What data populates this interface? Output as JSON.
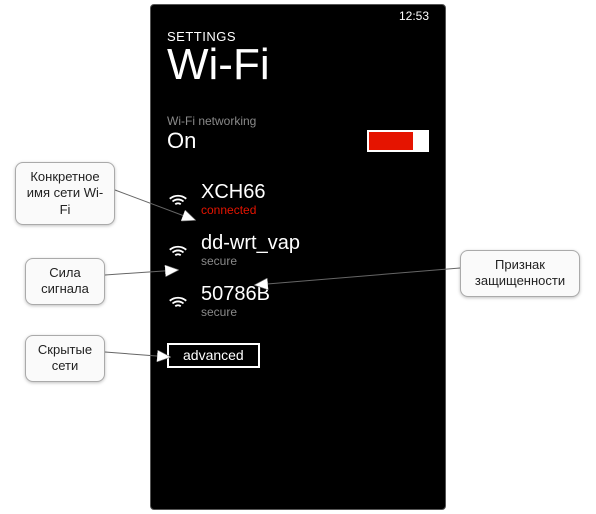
{
  "statusbar": {
    "time": "12:53"
  },
  "header": {
    "small": "SETTINGS",
    "big": "Wi-Fi"
  },
  "toggle": {
    "label": "Wi-Fi networking",
    "value": "On"
  },
  "networks": [
    {
      "name": "XCH66",
      "status_key": "connected",
      "status": "connected"
    },
    {
      "name": "dd-wrt_vap",
      "status_key": "secure",
      "status": "secure"
    },
    {
      "name": "50786B",
      "status_key": "secure",
      "status": "secure"
    }
  ],
  "advanced_label": "advanced",
  "callouts": {
    "name": "Конкретное имя сети Wi-Fi",
    "signal": "Сила сигнала",
    "hidden": "Скрытые сети",
    "secure": "Признак защищенности"
  }
}
